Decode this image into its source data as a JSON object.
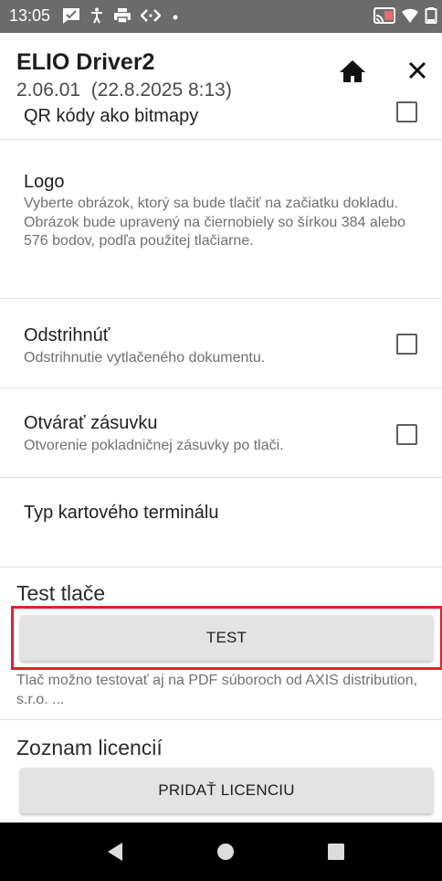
{
  "status_bar": {
    "time": "13:05",
    "icons": [
      "message-notification-icon",
      "accessibility-icon",
      "printer-icon",
      "code-icon",
      "dot-icon",
      "cast-icon",
      "wifi-icon",
      "battery-icon"
    ],
    "background": "#6b6b6b"
  },
  "app_bar": {
    "title": "ELIO Driver2",
    "subtitle": "2.06.01  (22.8.2025 8:13)",
    "actions": [
      "home-icon",
      "close-icon"
    ]
  },
  "preferences": [
    {
      "title": "QR kódy ako bitmapy",
      "summary": "",
      "checkbox": true,
      "checked": false
    },
    {
      "title": "Logo",
      "summary": "Vyberte obrázok, ktorý sa bude tlačiť na začiatku dokladu. Obrázok bude upravený na čiernobiely so šírkou 384 alebo 576 bodov, podľa použitej tlačiarne.",
      "checkbox": false
    },
    {
      "title": "Odstrihnúť",
      "summary": "Odstrihnutie vytlačeného dokumentu.",
      "checkbox": true,
      "checked": false
    },
    {
      "title": "Otvárať zásuvku",
      "summary": "Otvorenie pokladničnej zásuvky po tlači.",
      "checkbox": true,
      "checked": false
    },
    {
      "title": "Typ kartového terminálu",
      "summary": "",
      "checkbox": false
    }
  ],
  "test_section": {
    "title": "Test tlače",
    "button_label": "TEST",
    "note": "Tlač možno testovať aj na PDF súboroch od AXIS distribution, s.r.o. ...",
    "highlight_color": "#e0202a"
  },
  "license_section": {
    "title": "Zoznam licencií",
    "button_label": "PRIDAŤ LICENCIU"
  },
  "nav_bar": {
    "icons": [
      "back-icon",
      "home-circle-icon",
      "recents-icon"
    ]
  }
}
